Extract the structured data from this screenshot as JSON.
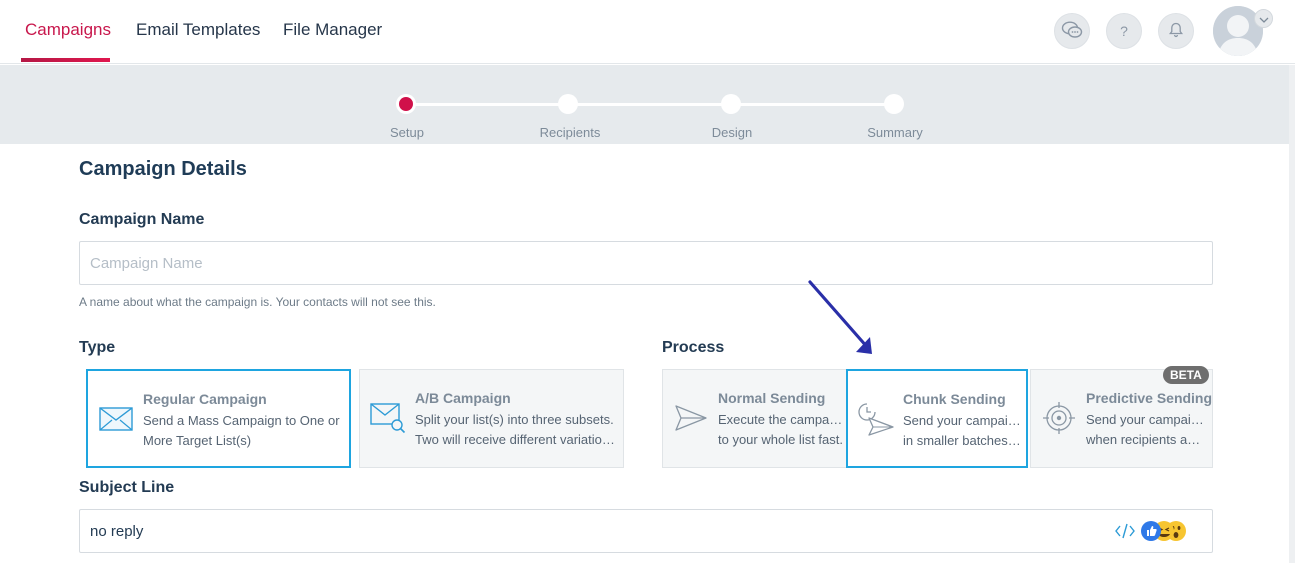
{
  "nav": {
    "tabs": [
      {
        "label": "Campaigns",
        "active": true
      },
      {
        "label": "Email Templates",
        "active": false
      },
      {
        "label": "File Manager",
        "active": false
      }
    ],
    "icons": [
      "chat-icon",
      "help-icon",
      "bell-icon",
      "avatar"
    ],
    "help_glyph": "?"
  },
  "stepper": {
    "steps": [
      "Setup",
      "Recipients",
      "Design",
      "Summary"
    ],
    "active_index": 0
  },
  "form": {
    "section_title": "Campaign Details",
    "campaign_name": {
      "label": "Campaign Name",
      "placeholder": "Campaign Name",
      "value": "",
      "help": "A name about what the campaign is. Your contacts will not see this."
    },
    "type": {
      "label": "Type",
      "options": [
        {
          "title": "Regular Campaign",
          "desc1": "Send a Mass Campaign to One or",
          "desc2": "More Target List(s)",
          "selected": true,
          "icon": "envelope-icon"
        },
        {
          "title": "A/B Campaign",
          "desc1": "Split your list(s) into three subsets.",
          "desc2": "Two will receive different variations …",
          "selected": false,
          "icon": "envelope-search-icon"
        }
      ]
    },
    "process": {
      "label": "Process",
      "options": [
        {
          "title": "Normal Sending",
          "desc1": "Execute the campaign",
          "desc2": "to your whole list fast.",
          "selected": false,
          "icon": "paper-plane-icon"
        },
        {
          "title": "Chunk Sending",
          "desc1": "Send your campaign",
          "desc2": "in smaller batches t…",
          "selected": true,
          "icon": "clock-plane-icon"
        },
        {
          "title": "Predictive Sending",
          "desc1": "Send your campaign",
          "desc2": "when recipients are…",
          "selected": false,
          "icon": "target-icon",
          "badge": "BETA"
        }
      ]
    },
    "subject": {
      "label": "Subject Line",
      "value": "no reply"
    }
  },
  "colors": {
    "accent": "#c8174c",
    "selected_border": "#1ea5e0",
    "arrow": "#2a2fa8"
  }
}
